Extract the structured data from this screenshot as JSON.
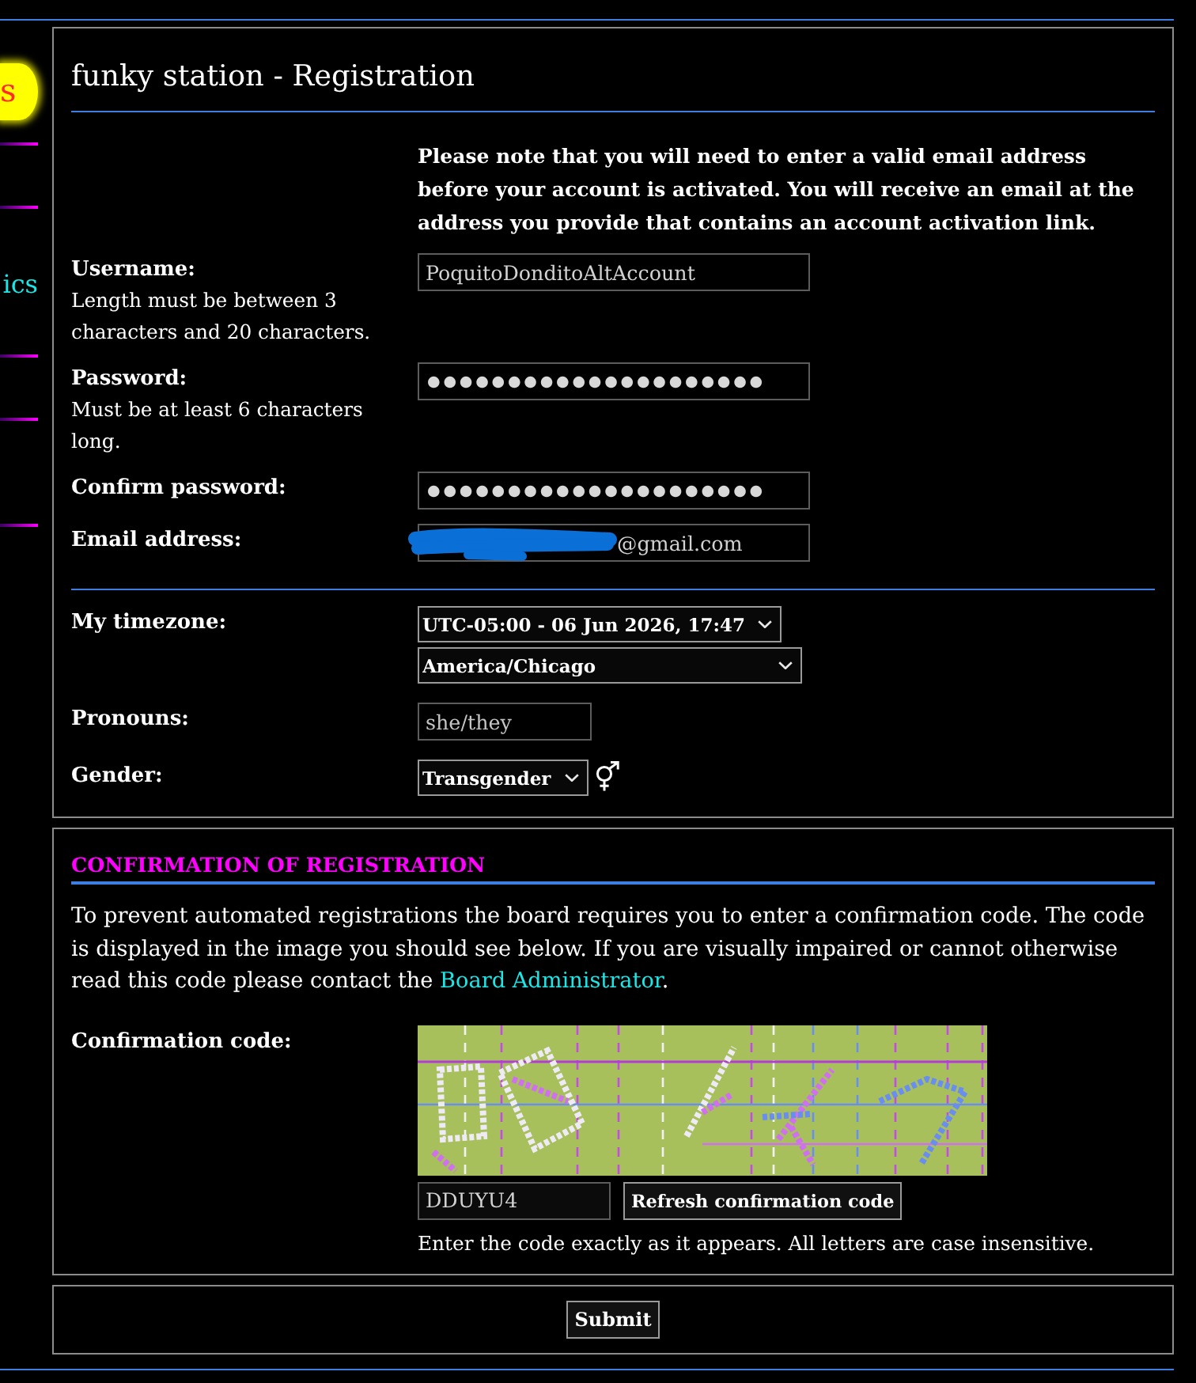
{
  "sidebar": {
    "items": [
      {
        "kind": "highlight",
        "label": "s"
      },
      {
        "kind": "link",
        "label": "ics"
      }
    ]
  },
  "registration": {
    "title": "funky station - Registration",
    "notice": "Please note that you will need to enter a valid email address before your account is activated. You will receive an email at the address you provide that contains an account activation link.",
    "fields": [
      {
        "kind": "text",
        "label": "Username:",
        "hint": "Length must be between 3 characters and 20 characters.",
        "value": "PoquitoDonditoAltAccount"
      },
      {
        "kind": "password",
        "label": "Password:",
        "hint": "Must be at least 6 characters long.",
        "value": "●●●●●●●●●●●●●●●●●●●●●"
      },
      {
        "kind": "password",
        "label": "Confirm password:",
        "value": "●●●●●●●●●●●●●●●●●●●●●"
      },
      {
        "kind": "email",
        "label": "Email address:",
        "value": "@gmail.com",
        "redacted": true
      }
    ],
    "settings": [
      {
        "kind": "select",
        "label": "My timezone:",
        "values": [
          "UTC-05:00 - 06 Jun 2026, 17:47",
          "America/Chicago"
        ]
      },
      {
        "kind": "text",
        "label": "Pronouns:",
        "value": "she/they"
      },
      {
        "kind": "gender",
        "label": "Gender:",
        "value": "Transgender"
      }
    ]
  },
  "confirmation": {
    "heading": "CONFIRMATION OF REGISTRATION",
    "intro": "To prevent automated registrations the board requires you to enter a confirmation code. The code is displayed in the image you should see below. If you are visually impaired or cannot otherwise read this code please contact the ",
    "link": "Board Administrator",
    "intro_end": ".",
    "code_label": "Confirmation code:",
    "code_value": "DDUYU4",
    "refresh_button": "Refresh confirmation code",
    "code_hint": "Enter the code exactly as it appears. All letters are case insensitive."
  },
  "submit_button": "Submit"
}
